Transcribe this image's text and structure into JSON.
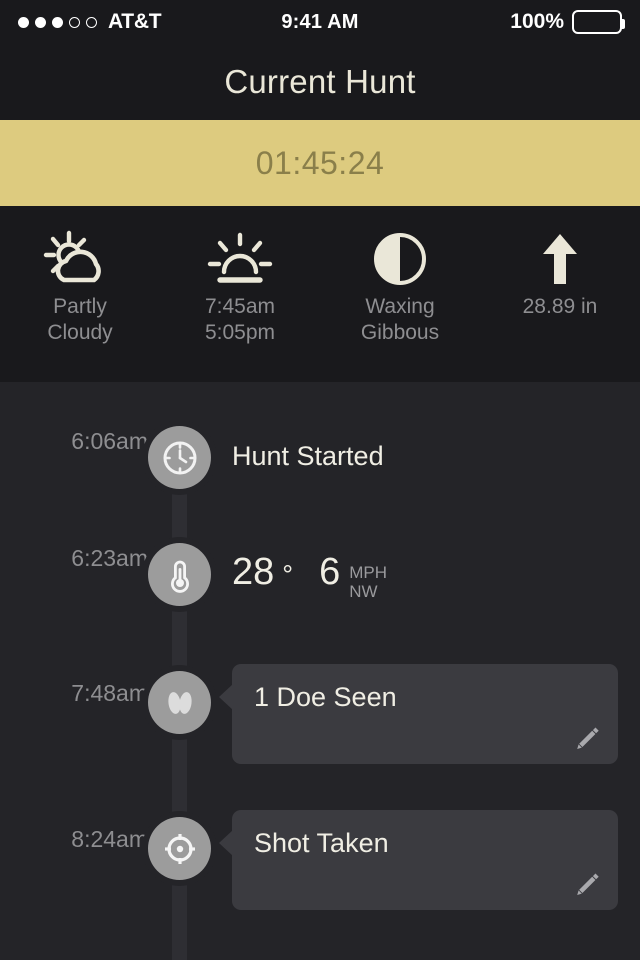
{
  "status_bar": {
    "signal_dots_filled": 3,
    "signal_dots_empty": 2,
    "carrier": "AT&T",
    "time": "9:41 AM",
    "battery_percent": "100%"
  },
  "nav": {
    "title": "Current Hunt"
  },
  "timer": {
    "elapsed": "01:45:24",
    "bar_color": "#ddcb7f",
    "text_color": "#8a7f4a"
  },
  "weather": [
    {
      "icon": "partly-cloudy-icon",
      "label": "Partly\nCloudy"
    },
    {
      "icon": "sunrise-sunset-icon",
      "label": "7:45am\n5:05pm"
    },
    {
      "icon": "moon-phase-icon",
      "label": "Waxing\nGibbous"
    },
    {
      "icon": "pressure-up-arrow-icon",
      "label": "28.89 in"
    }
  ],
  "timeline": [
    {
      "time": "6:06am",
      "icon": "clock-icon",
      "type": "text",
      "title": "Hunt Started"
    },
    {
      "time": "6:23am",
      "icon": "thermometer-icon",
      "type": "conditions",
      "temperature": "28",
      "degree_symbol": "°",
      "wind_speed": "6",
      "wind_units": "MPH\nNW"
    },
    {
      "time": "7:48am",
      "icon": "deer-track-icon",
      "type": "card",
      "title": "1 Doe Seen",
      "edit_icon": "pencil-icon"
    },
    {
      "time": "8:24am",
      "icon": "crosshair-icon",
      "type": "card",
      "title": "Shot Taken",
      "edit_icon": "pencil-icon"
    }
  ]
}
